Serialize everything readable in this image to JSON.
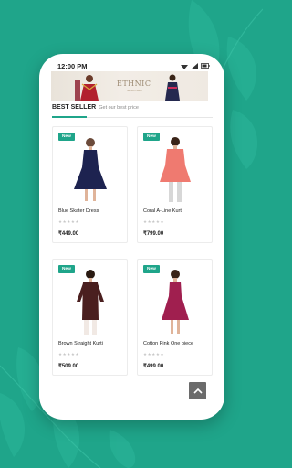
{
  "status_bar": {
    "time": "12:00 PM"
  },
  "banner": {
    "title": "ETHNIC",
    "subtitle": "fashion wear"
  },
  "section": {
    "title": "BEST SELLER",
    "subtitle": "Get our best price"
  },
  "products": [
    {
      "badge": "New",
      "name": "Blue Skater Dress",
      "stars": "★★★★★",
      "price": "₹449.00",
      "dress_color": "#1d2350"
    },
    {
      "badge": "New",
      "name": "Coral A-Line Kurti",
      "stars": "★★★★★",
      "price": "₹799.00",
      "dress_color": "#ef7a70"
    },
    {
      "badge": "New",
      "name": "Brown Straight Kurti",
      "stars": "★★★★★",
      "price": "₹509.00",
      "dress_color": "#4a1f1f"
    },
    {
      "badge": "New",
      "name": "Cotton Pink One piece",
      "stars": "★★★★★",
      "price": "₹499.00",
      "dress_color": "#a01f4f"
    }
  ],
  "scroll_top": {
    "icon": "chevron-up-icon"
  },
  "colors": {
    "brand": "#1fa58a",
    "background": "#1fa58a"
  }
}
